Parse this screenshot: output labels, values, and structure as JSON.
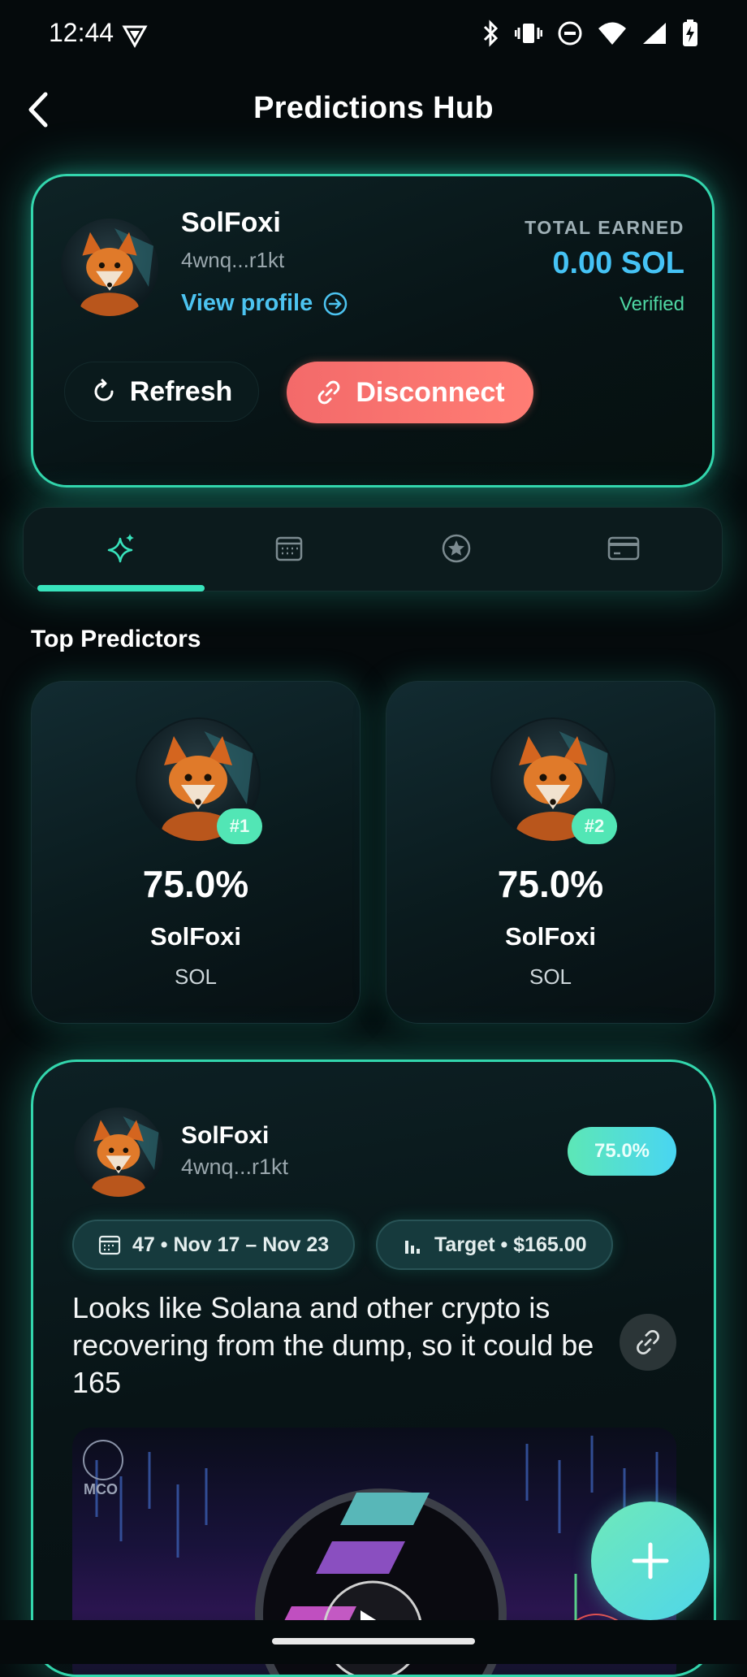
{
  "status_bar": {
    "time": "12:44"
  },
  "header": {
    "title": "Predictions Hub"
  },
  "profile": {
    "name": "SolFoxi",
    "address": "4wnq...r1kt",
    "view_profile": "View profile",
    "total_earned_label": "TOTAL EARNED",
    "total_earned_value": "0.00 SOL",
    "verified": "Verified",
    "refresh_label": "Refresh",
    "disconnect_label": "Disconnect"
  },
  "tabs": [
    {
      "icon": "sparkles-icon",
      "active": true
    },
    {
      "icon": "calendar-icon",
      "active": false
    },
    {
      "icon": "star-circle-icon",
      "active": false
    },
    {
      "icon": "card-icon",
      "active": false
    }
  ],
  "top_predictors": {
    "title": "Top Predictors",
    "items": [
      {
        "rank": "#1",
        "accuracy": "75.0%",
        "name": "SolFoxi",
        "asset": "SOL"
      },
      {
        "rank": "#2",
        "accuracy": "75.0%",
        "name": "SolFoxi",
        "asset": "SOL"
      }
    ]
  },
  "post": {
    "name": "SolFoxi",
    "address": "4wnq...r1kt",
    "accuracy": "75.0%",
    "week_chip": "47 • Nov 17 – Nov 23",
    "target_chip": "Target • $165.00",
    "text": "Looks like Solana and other crypto is recovering from the dump, so it could be 165",
    "image_watermark": "MCO"
  },
  "colors": {
    "accent": "#33d6ad",
    "link": "#4cc3f0",
    "earned": "#45c3f5",
    "verified": "#4ed7a3",
    "danger": "#f36a6a"
  }
}
